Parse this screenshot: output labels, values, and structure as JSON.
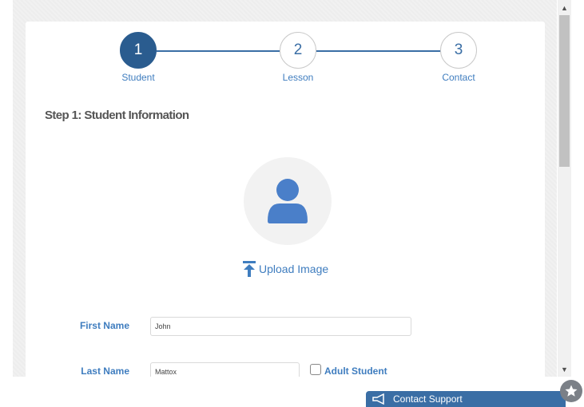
{
  "stepper": {
    "steps": [
      {
        "number": "1",
        "label": "Student"
      },
      {
        "number": "2",
        "label": "Lesson"
      },
      {
        "number": "3",
        "label": "Contact"
      }
    ],
    "active_step": 1
  },
  "section_title": "Step 1: Student Information",
  "upload": {
    "label": "Upload Image"
  },
  "form": {
    "first_name": {
      "label": "First Name",
      "value": "John"
    },
    "last_name": {
      "label": "Last Name",
      "value": "Mattox"
    },
    "adult_student": {
      "label": "Adult Student",
      "checked": false
    }
  },
  "support": {
    "label": "Contact Support"
  },
  "colors": {
    "accent": "#3f7dbf",
    "active_step": "#2a5c8f",
    "avatar_icon": "#4a7fc9"
  }
}
